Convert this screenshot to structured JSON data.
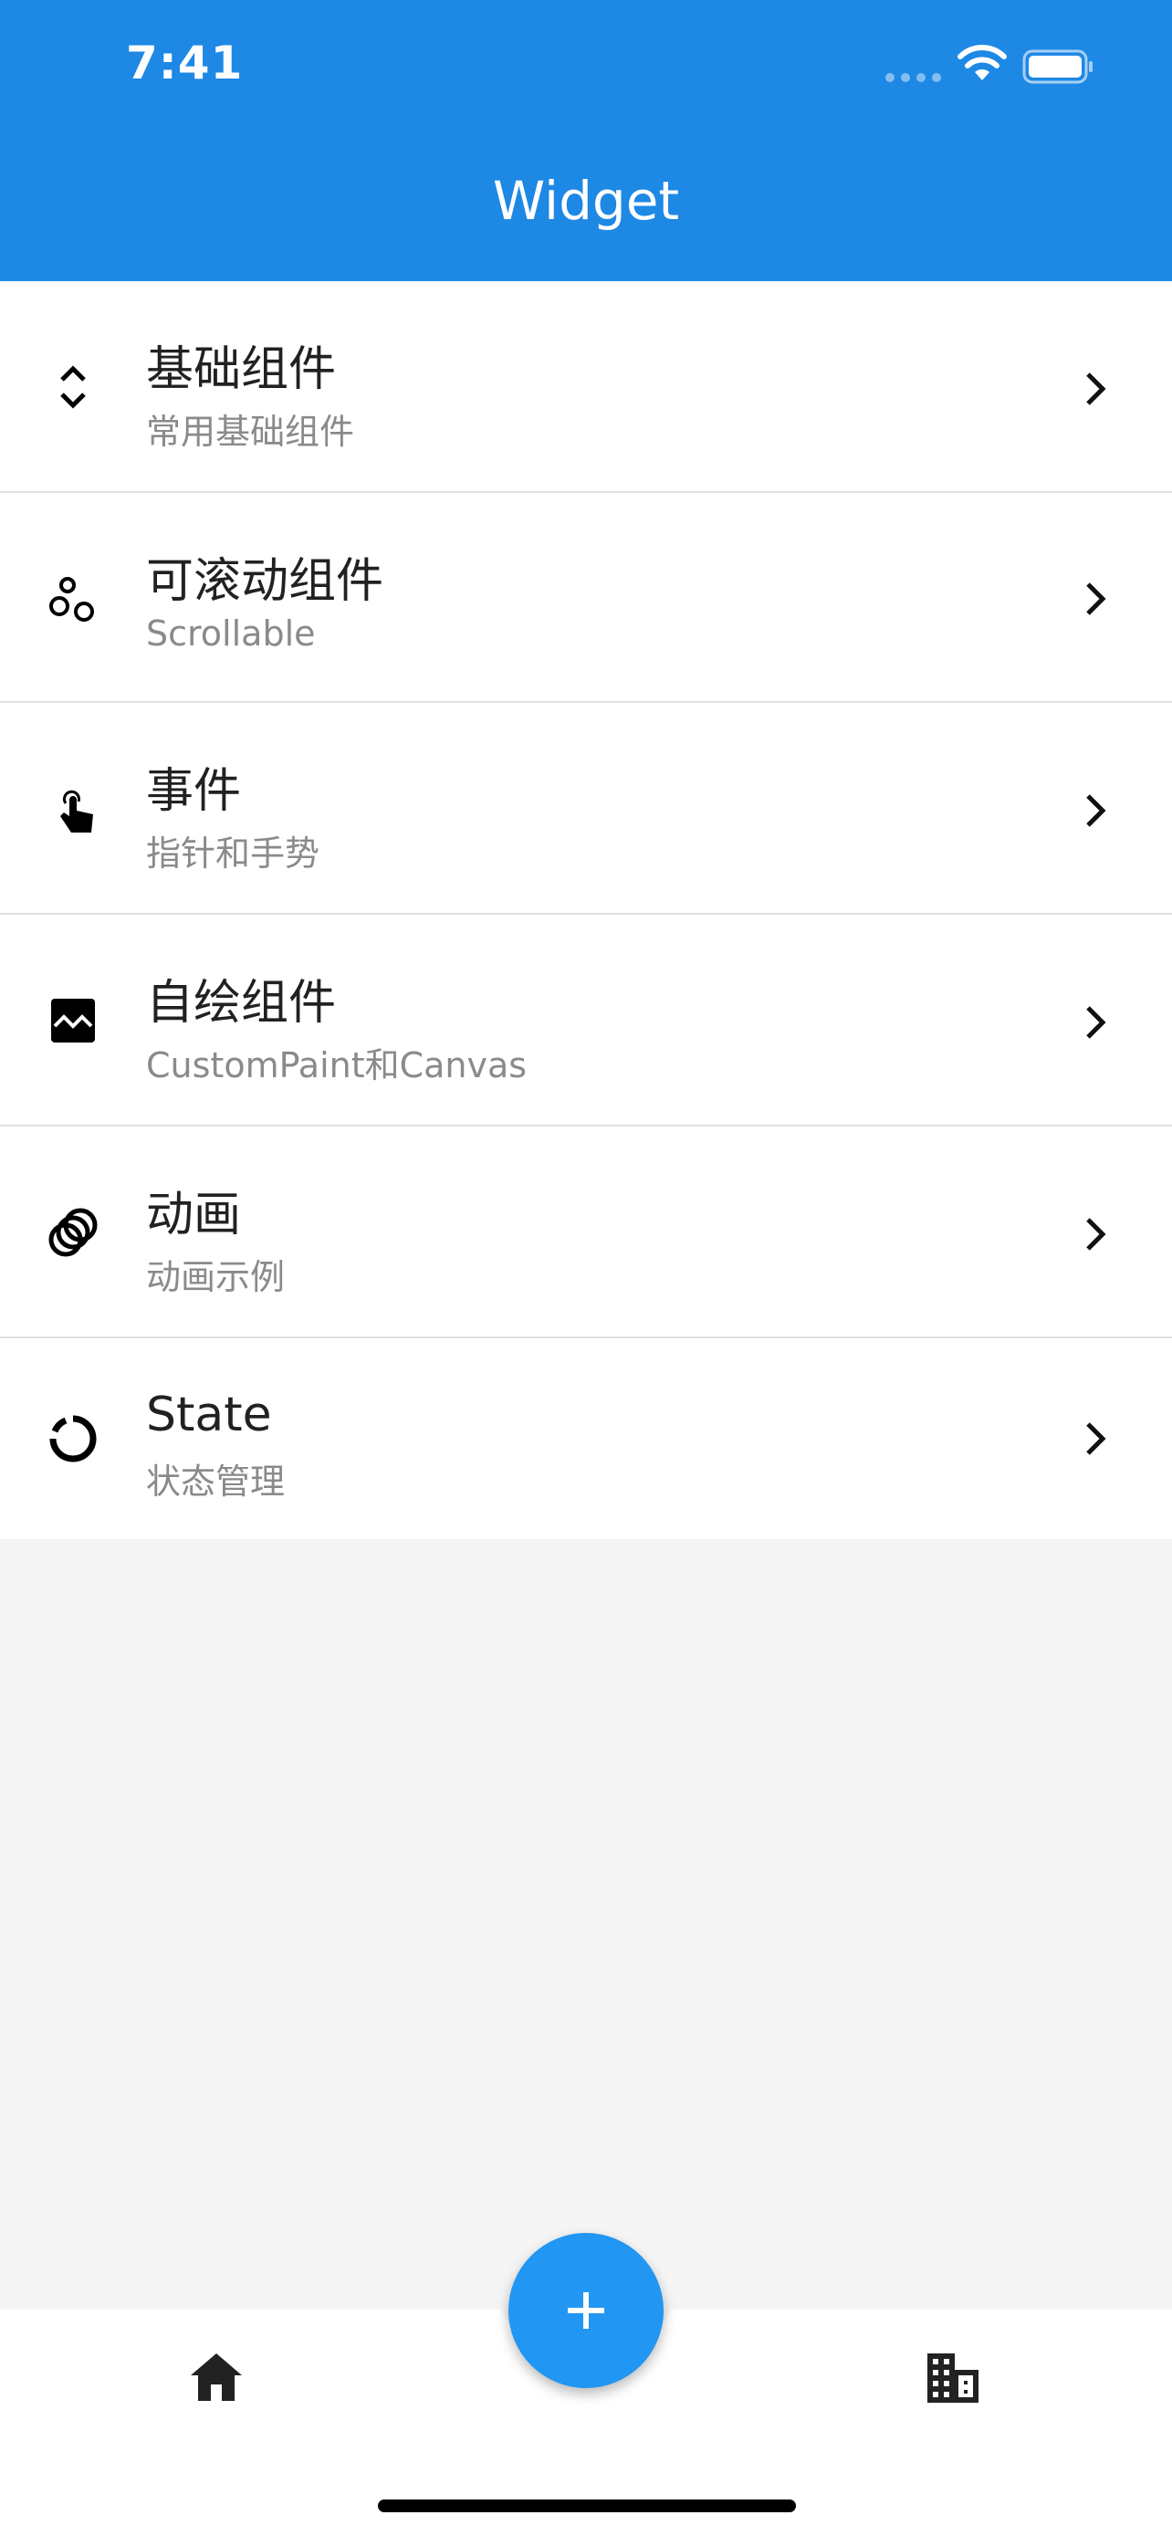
{
  "status_bar": {
    "time": "7:41"
  },
  "app_bar": {
    "title": "Widget",
    "color": "#1e88e5"
  },
  "items": [
    {
      "title": "基础组件",
      "subtitle": "常用基础组件",
      "icon": "unfold-more-icon"
    },
    {
      "title": "可滚动组件",
      "subtitle": "Scrollable",
      "icon": "bubbles-icon"
    },
    {
      "title": "事件",
      "subtitle": "指针和手势",
      "icon": "touch-app-icon"
    },
    {
      "title": "自绘组件",
      "subtitle": "CustomPaint和Canvas",
      "icon": "broken-image-icon"
    },
    {
      "title": "动画",
      "subtitle": "动画示例",
      "icon": "animation-icon"
    },
    {
      "title": "State",
      "subtitle": "状态管理",
      "icon": "data-usage-icon"
    }
  ],
  "bottom_nav": {
    "items": [
      {
        "icon": "home-icon"
      },
      {
        "icon": "business-icon"
      }
    ],
    "fab_icon": "add-icon",
    "fab_color": "#2196f3"
  }
}
